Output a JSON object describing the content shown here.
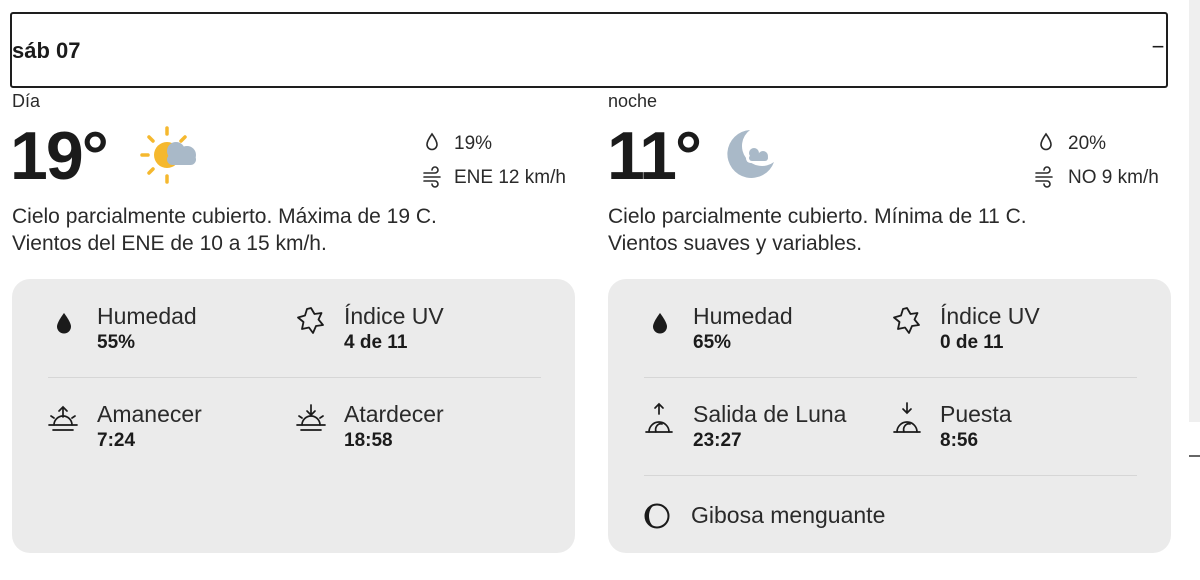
{
  "header": {
    "day": "sáb 07",
    "collapse_icon": "−"
  },
  "day": {
    "period": "Día",
    "temp": "19°",
    "icon": "partly-cloudy-day-icon",
    "precip": "19%",
    "wind": "ENE 12 km/h",
    "desc_line1": "Cielo parcialmente cubierto. Máxima de 19 C.",
    "desc_line2": "Vientos del ENE de 10 a 15 km/h.",
    "details": {
      "humidity_label": "Humedad",
      "humidity_value": "55%",
      "uv_label": "Índice UV",
      "uv_value": "4 de 11",
      "sunrise_label": "Amanecer",
      "sunrise_value": "7:24",
      "sunset_label": "Atardecer",
      "sunset_value": "18:58"
    }
  },
  "night": {
    "period": "noche",
    "temp": "11°",
    "icon": "partly-cloudy-night-icon",
    "precip": "20%",
    "wind": "NO 9 km/h",
    "desc_line1": "Cielo parcialmente cubierto. Mínima de 11 C.",
    "desc_line2": "Vientos suaves y variables.",
    "details": {
      "humidity_label": "Humedad",
      "humidity_value": "65%",
      "uv_label": "Índice UV",
      "uv_value": "0 de 11",
      "moonrise_label": "Salida de Luna",
      "moonrise_value": "23:27",
      "moonset_label": "Puesta",
      "moonset_value": "8:56",
      "moon_phase": "Gibosa menguante"
    }
  },
  "colors": {
    "sun": "#f5b82e",
    "cloud": "#a9b9c8",
    "card_bg": "#ebebeb",
    "text": "#1b1b1b"
  }
}
